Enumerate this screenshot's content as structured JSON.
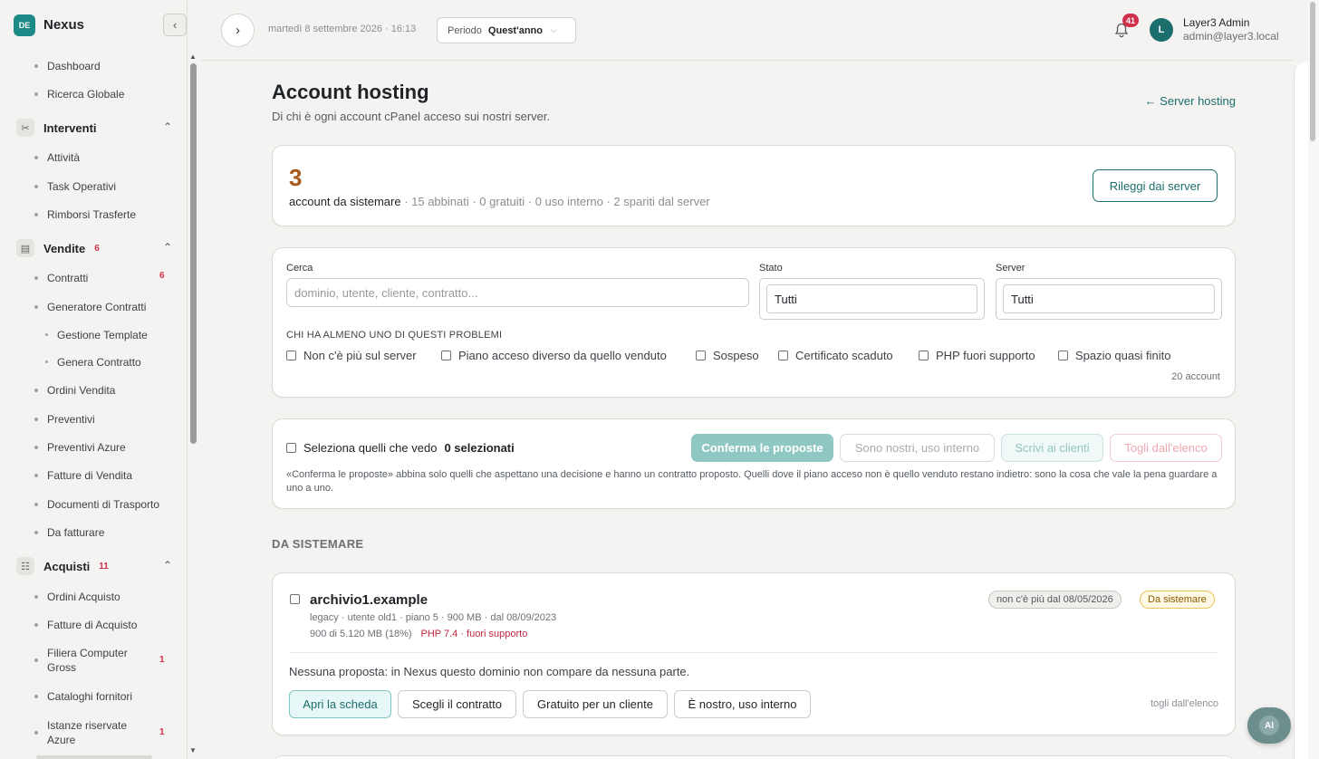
{
  "app": {
    "badge": "DE",
    "name": "Nexus"
  },
  "sidebar": {
    "items_top": [
      {
        "label": "Dashboard"
      },
      {
        "label": "Ricerca Globale"
      }
    ],
    "groups": [
      {
        "label": "Interventi",
        "count": "",
        "items": [
          {
            "label": "Attività"
          },
          {
            "label": "Task Operativi"
          },
          {
            "label": "Rimborsi Trasferte"
          }
        ]
      },
      {
        "label": "Vendite",
        "count": "6",
        "items": [
          {
            "label": "Contratti",
            "count": "6"
          },
          {
            "label": "Generatore Contratti"
          },
          {
            "label": "Gestione Template"
          },
          {
            "label": "Genera Contratto"
          },
          {
            "label": "Ordini Vendita"
          },
          {
            "label": "Preventivi"
          },
          {
            "label": "Preventivi Azure"
          },
          {
            "label": "Fatture di Vendita"
          },
          {
            "label": "Documenti di Trasporto"
          },
          {
            "label": "Da fatturare"
          }
        ]
      },
      {
        "label": "Acquisti",
        "count": "11",
        "items": [
          {
            "label": "Ordini Acquisto"
          },
          {
            "label": "Fatture di Acquisto"
          },
          {
            "label": "Filiera Computer Gross",
            "count": "1"
          },
          {
            "label": "Cataloghi fornitori"
          },
          {
            "label": "Istanze riservate Azure",
            "count": "1"
          }
        ]
      }
    ]
  },
  "topbar": {
    "date": "martedì 8 settembre 2026 · 16:13",
    "period_label": "Periodo",
    "period_value": "Quest'anno",
    "notifications": "41",
    "avatar_letter": "L",
    "user_name": "Layer3 Admin",
    "user_email": "admin@layer3.local"
  },
  "page": {
    "title": "Account hosting",
    "subtitle": "Di chi è ogni account cPanel acceso sui nostri server.",
    "back_link": "← Server hosting"
  },
  "summary": {
    "number": "3",
    "label": "account da sistemare",
    "rest": " · 15 abbinati · 0 gratuiti · 0 uso interno · 2 spariti dal server",
    "reread_button": "Rileggi dai server"
  },
  "filters": {
    "search_label": "Cerca",
    "search_placeholder": "dominio, utente, cliente, contratto...",
    "state_label": "Stato",
    "state_value": "Tutti",
    "server_label": "Server",
    "server_value": "Tutti",
    "problems_title": "CHI HA ALMENO UNO DI QUESTI PROBLEMI",
    "problems": [
      "Non c'è più sul server",
      "Piano acceso diverso da quello venduto",
      "Sospeso",
      "Certificato scaduto",
      "PHP fuori supporto",
      "Spazio quasi finito"
    ],
    "account_count": "20 account"
  },
  "bulk": {
    "select_label": "Seleziona quelli che vedo",
    "selected": "0 selezionati",
    "confirm": "Conferma le proposte",
    "internal": "Sono nostri, uso interno",
    "write": "Scrivi ai clienti",
    "remove": "Togli dall'elenco",
    "note": "«Conferma le proposte» abbina solo quelli che aspettano una decisione e hanno un contratto proposto. Quelli dove il piano acceso non è quello venduto restano indietro: sono la cosa che vale la pena guardare a uno a uno."
  },
  "section_title": "DA SISTEMARE",
  "account": {
    "domain": "archivio1.example",
    "meta": "legacy · utente old1 · piano 5 · 900 MB · dal 08/09/2023",
    "usage": "900 di 5.120 MB (18%)",
    "php": "PHP 7.4 · fuori supporto",
    "chip_gone": "non c'è più dal 08/05/2026",
    "chip_status": "Da sistemare",
    "note": "Nessuna proposta: in Nexus questo dominio non compare da nessuna parte.",
    "btn_open": "Apri la scheda",
    "btn_choose": "Scegli il contratto",
    "btn_free": "Gratuito per un cliente",
    "btn_internal": "È nostro, uso interno",
    "remove_link": "togli dall'elenco"
  },
  "ai_button": "AI",
  "colors": {
    "accent": "#1b6e6b",
    "brand": "#1b8a86",
    "danger": "#d1304a",
    "warning_number": "#a8591c"
  }
}
